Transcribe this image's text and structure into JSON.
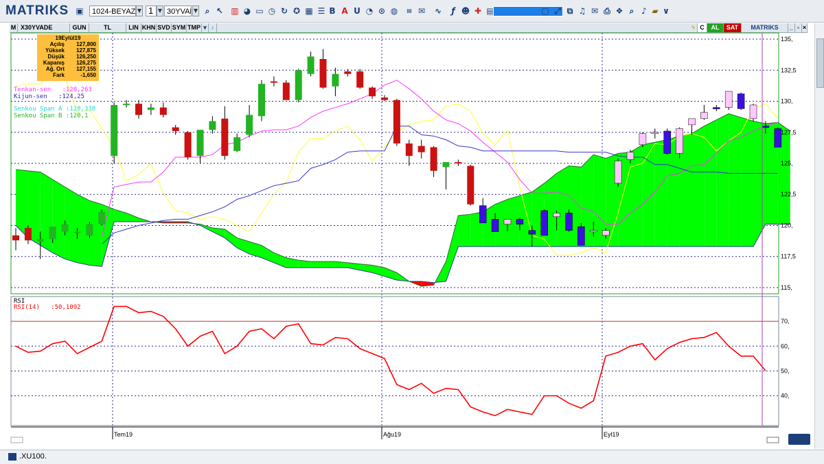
{
  "toolbar": {
    "logo": "MATRIKS",
    "layout_combo": "1024-BEYAZ-1",
    "page_combo": "1",
    "symbol_combo": "30YVADE",
    "dropdown_glyph": "▼",
    "buttons": [
      "B",
      "A",
      "U"
    ]
  },
  "chart_bar": {
    "symbol": "X30YVADE",
    "tabs": [
      "GUN",
      "TL",
      "LIN",
      "KHN",
      "SVD",
      "SYM",
      "TMP"
    ],
    "right_labels": [
      "C",
      "AL",
      "SAT"
    ],
    "brand": "MATRIKS",
    "left_label": "M"
  },
  "info_box": {
    "date": "19Eylül19",
    "rows": [
      {
        "label": "Açılış",
        "value": "127,800"
      },
      {
        "label": "Yüksek",
        "value": "127,875"
      },
      {
        "label": "Düşük",
        "value": "126,250"
      },
      {
        "label": "Kapanış",
        "value": "126,275"
      },
      {
        "label": "Ağ. Ort",
        "value": "127,155"
      },
      {
        "label": "Fark",
        "value": "-1,650"
      }
    ]
  },
  "legends": {
    "tenkan": "Tenkan-sen   :128,263",
    "kijun": "Kijun-sen   :124,25",
    "span_a": "Senkou Span A :128,338",
    "span_b": "Senkou Span B :120,1"
  },
  "rsi": {
    "title": "RSI",
    "label": "RSI(14)   :50,1092"
  },
  "status": {
    "text": ".XU100."
  },
  "colors": {
    "bull": "#22b422",
    "bear": "#cc1111",
    "cloud_bull": "#00ff00",
    "cloud_bear": "#ff0000",
    "tenkan": "#ff33ff",
    "kijun": "#3333cc",
    "chikou": "#ffff33",
    "rsi": "#ff0000"
  },
  "chart_data": [
    {
      "type": "candlestick",
      "title": "X30YVADE",
      "x_ticks": [
        "Tem19",
        "Ağu19",
        "Eyl19"
      ],
      "y_ticks": [
        "135,",
        "132,5",
        "130,",
        "127,5",
        "125,",
        "122,5",
        "120,",
        "117,5",
        "115,"
      ],
      "ylim": [
        114.5,
        135.5
      ],
      "candles": [
        {
          "o": 119.2,
          "h": 119.8,
          "l": 118.0,
          "c": 118.8
        },
        {
          "o": 119.8,
          "h": 120.0,
          "l": 118.5,
          "c": 118.8
        },
        {
          "o": 118.7,
          "h": 119.5,
          "l": 117.3,
          "c": 118.9
        },
        {
          "o": 118.9,
          "h": 119.9,
          "l": 118.6,
          "c": 119.9
        },
        {
          "o": 119.5,
          "h": 120.4,
          "l": 119.2,
          "c": 120.1
        },
        {
          "o": 119.4,
          "h": 119.8,
          "l": 118.9,
          "c": 119.5
        },
        {
          "o": 119.2,
          "h": 120.3,
          "l": 119.0,
          "c": 120.1
        },
        {
          "o": 120.1,
          "h": 121.3,
          "l": 120.0,
          "c": 121.1
        },
        {
          "o": 125.6,
          "h": 129.9,
          "l": 125.0,
          "c": 129.7
        },
        {
          "o": 129.7,
          "h": 130.1,
          "l": 129.5,
          "c": 129.8
        },
        {
          "o": 129.8,
          "h": 130.1,
          "l": 128.6,
          "c": 128.9
        },
        {
          "o": 129.3,
          "h": 129.8,
          "l": 128.9,
          "c": 129.5
        },
        {
          "o": 129.5,
          "h": 129.9,
          "l": 128.7,
          "c": 128.9
        },
        {
          "o": 127.9,
          "h": 128.1,
          "l": 127.3,
          "c": 127.6
        },
        {
          "o": 127.5,
          "h": 127.6,
          "l": 125.3,
          "c": 125.5
        },
        {
          "o": 125.6,
          "h": 127.6,
          "l": 125.0,
          "c": 127.7
        },
        {
          "o": 127.7,
          "h": 128.8,
          "l": 127.4,
          "c": 128.4
        },
        {
          "o": 128.6,
          "h": 129.6,
          "l": 125.3,
          "c": 125.6
        },
        {
          "o": 126.0,
          "h": 127.4,
          "l": 125.9,
          "c": 127.1
        },
        {
          "o": 127.3,
          "h": 129.7,
          "l": 127.1,
          "c": 128.9
        },
        {
          "o": 128.8,
          "h": 131.7,
          "l": 128.4,
          "c": 131.4
        },
        {
          "o": 131.6,
          "h": 132.0,
          "l": 131.2,
          "c": 131.5
        },
        {
          "o": 131.5,
          "h": 131.7,
          "l": 130.1,
          "c": 130.1
        },
        {
          "o": 130.1,
          "h": 132.6,
          "l": 129.9,
          "c": 132.5
        },
        {
          "o": 132.2,
          "h": 134.0,
          "l": 132.0,
          "c": 133.6
        },
        {
          "o": 133.4,
          "h": 134.2,
          "l": 131.0,
          "c": 131.1
        },
        {
          "o": 131.2,
          "h": 132.7,
          "l": 130.4,
          "c": 132.2
        },
        {
          "o": 132.4,
          "h": 132.6,
          "l": 132.0,
          "c": 132.2
        },
        {
          "o": 132.4,
          "h": 132.6,
          "l": 131.0,
          "c": 131.1
        },
        {
          "o": 131.1,
          "h": 131.2,
          "l": 130.2,
          "c": 130.4
        },
        {
          "o": 130.3,
          "h": 130.5,
          "l": 130.0,
          "c": 130.1
        },
        {
          "o": 130.1,
          "h": 130.2,
          "l": 126.4,
          "c": 126.6
        },
        {
          "o": 126.6,
          "h": 126.9,
          "l": 124.8,
          "c": 125.6
        },
        {
          "o": 126.4,
          "h": 126.9,
          "l": 125.4,
          "c": 125.9
        },
        {
          "o": 126.3,
          "h": 126.4,
          "l": 123.9,
          "c": 124.4
        },
        {
          "o": 124.7,
          "h": 125.0,
          "l": 122.9,
          "c": 125.1
        },
        {
          "o": 125.1,
          "h": 125.3,
          "l": 124.8,
          "c": 125.0
        },
        {
          "o": 124.8,
          "h": 124.9,
          "l": 121.6,
          "c": 121.7
        },
        {
          "o": 121.6,
          "h": 122.2,
          "l": 120.7,
          "c": 120.2
        },
        {
          "o": 120.5,
          "h": 121.0,
          "l": 119.5,
          "c": 119.5
        },
        {
          "o": 120.1,
          "h": 120.5,
          "l": 119.5,
          "c": 120.5
        },
        {
          "o": 120.5,
          "h": 120.6,
          "l": 119.6,
          "c": 120.1
        },
        {
          "o": 119.6,
          "h": 120.0,
          "l": 118.3,
          "c": 119.3
        },
        {
          "o": 121.2,
          "h": 121.3,
          "l": 119.2,
          "c": 119.2
        },
        {
          "o": 120.7,
          "h": 121.2,
          "l": 119.6,
          "c": 121.0
        },
        {
          "o": 121.0,
          "h": 121.3,
          "l": 119.5,
          "c": 119.6
        },
        {
          "o": 119.9,
          "h": 120.2,
          "l": 118.4,
          "c": 118.4
        },
        {
          "o": 119.6,
          "h": 120.3,
          "l": 119.1,
          "c": 119.6
        },
        {
          "o": 119.2,
          "h": 119.8,
          "l": 118.9,
          "c": 119.6
        },
        {
          "o": 123.4,
          "h": 125.4,
          "l": 123.1,
          "c": 125.2
        },
        {
          "o": 125.3,
          "h": 126.1,
          "l": 125.0,
          "c": 125.9
        },
        {
          "o": 126.5,
          "h": 127.5,
          "l": 126.3,
          "c": 127.4
        },
        {
          "o": 127.4,
          "h": 127.8,
          "l": 127.0,
          "c": 127.5
        },
        {
          "o": 127.6,
          "h": 127.8,
          "l": 125.7,
          "c": 125.8
        },
        {
          "o": 125.8,
          "h": 127.9,
          "l": 125.4,
          "c": 127.8
        },
        {
          "o": 128.1,
          "h": 128.3,
          "l": 127.3,
          "c": 128.6
        },
        {
          "o": 128.6,
          "h": 129.7,
          "l": 128.5,
          "c": 129.1
        },
        {
          "o": 129.5,
          "h": 129.7,
          "l": 129.2,
          "c": 129.4
        },
        {
          "o": 129.5,
          "h": 130.8,
          "l": 129.3,
          "c": 130.8
        },
        {
          "o": 130.6,
          "h": 130.7,
          "l": 129.3,
          "c": 129.4
        },
        {
          "o": 128.6,
          "h": 129.8,
          "l": 128.4,
          "c": 129.7
        },
        {
          "o": 128.0,
          "h": 128.4,
          "l": 127.4,
          "c": 127.9
        },
        {
          "o": 127.8,
          "h": 127.9,
          "l": 126.3,
          "c": 126.3
        }
      ],
      "tenkan": [
        null,
        null,
        null,
        null,
        null,
        null,
        null,
        119.1,
        123.1,
        123.3,
        123.5,
        123.5,
        124.3,
        125.5,
        125.5,
        125.5,
        125.7,
        126.5,
        126.7,
        127.2,
        127.6,
        127.7,
        127.7,
        128.0,
        128.7,
        129.2,
        129.5,
        129.8,
        130.2,
        130.6,
        131.3,
        131.7,
        131.0,
        130.2,
        129.2,
        128.5,
        128.2,
        127.6,
        126.7,
        125.9,
        125.1,
        123.7,
        122.6,
        122.6,
        122.7,
        122.4,
        121.4,
        121.1,
        120.1,
        120.1,
        121.0,
        121.7,
        122.7,
        124.0,
        124.2,
        124.8,
        124.9,
        125.8,
        126.8,
        127.1,
        127.6,
        128.0,
        128.3
      ],
      "kijun": [
        null,
        null,
        null,
        null,
        null,
        null,
        null,
        118.5,
        119.4,
        119.7,
        120.0,
        120.2,
        120.4,
        120.5,
        120.5,
        120.8,
        121.1,
        121.5,
        122.1,
        122.4,
        122.8,
        123.2,
        123.4,
        123.6,
        124.6,
        124.9,
        125.3,
        125.9,
        126.0,
        126.0,
        126.0,
        128.0,
        128.0,
        127.3,
        127.2,
        126.9,
        126.4,
        126.3,
        126.0,
        126.0,
        126.0,
        126.0,
        126.0,
        126.0,
        126.0,
        125.9,
        125.9,
        125.9,
        125.9,
        125.6,
        125.5,
        125.5,
        124.9,
        124.9,
        124.6,
        124.3,
        124.3,
        124.3,
        124.2,
        124.2,
        124.2,
        124.2,
        124.2
      ],
      "chikou": [
        131.2,
        131.4,
        131.4,
        132.6,
        132.0,
        129.1,
        129.3,
        127.8,
        126.3,
        123.6,
        124.1,
        125.0,
        122.6,
        121.2,
        121.0,
        120.5,
        120.7,
        120.5,
        120.0,
        119.5,
        121.0,
        122.5,
        123.5,
        125.9,
        127.0,
        127.0,
        127.6,
        128.0,
        126.9,
        125.2,
        126.3,
        127.5,
        128.1,
        128.4,
        128.5,
        129.6,
        129.8,
        129.2,
        127.4,
        126.5,
        127.7,
        123.1,
        119.2,
        118.9,
        117.6,
        117.6,
        117.8,
        118.2,
        117.8,
        121.0,
        124.7,
        125.0,
        126.6,
        126.5,
        127.2,
        127.4,
        127.1,
        126.0,
        126.8,
        127.5,
        129.4,
        129.8,
        128.6
      ],
      "span_a": [
        124.5,
        124.4,
        124.3,
        123.7,
        123.1,
        122.5,
        122.0,
        121.7,
        121.3,
        121.0,
        120.6,
        120.3,
        120.2,
        120.2,
        120.2,
        120.1,
        119.8,
        119.7,
        119.0,
        118.7,
        118.4,
        117.8,
        117.4,
        117.2,
        117.1,
        117.1,
        117.1,
        117.0,
        116.9,
        116.8,
        116.6,
        116.2,
        115.5,
        115.1,
        115.2,
        117.1,
        120.8,
        120.9,
        121.1,
        121.7,
        122.1,
        122.4,
        122.7,
        123.4,
        124.2,
        124.8,
        124.7,
        125.7,
        125.4,
        125.8,
        125.9,
        126.5,
        126.7,
        126.9,
        127.2,
        127.4,
        128.0,
        128.5,
        129.0,
        128.7,
        128.4,
        128.2,
        128.3,
        127.6
      ],
      "span_b": [
        120.0,
        119.0,
        118.4,
        117.8,
        117.3,
        117.0,
        116.8,
        116.7,
        120.3,
        120.3,
        120.3,
        120.3,
        120.3,
        120.3,
        120.3,
        120.0,
        119.5,
        119.0,
        118.2,
        117.7,
        117.4,
        117.0,
        116.6,
        116.6,
        116.6,
        116.6,
        116.6,
        116.6,
        116.4,
        116.2,
        115.9,
        115.6,
        115.5,
        115.5,
        115.4,
        115.5,
        118.3,
        118.3,
        118.3,
        118.3,
        118.3,
        118.3,
        118.3,
        118.3,
        118.3,
        118.3,
        118.3,
        118.3,
        118.3,
        118.3,
        118.3,
        118.3,
        118.3,
        118.3,
        118.3,
        118.3,
        118.3,
        118.3,
        118.3,
        118.3,
        118.3,
        120.1,
        120.1,
        120.1
      ]
    },
    {
      "type": "line",
      "title": "RSI",
      "series": [
        {
          "name": "RSI(14)",
          "values": [
            60.0,
            57.5,
            58.0,
            61.0,
            62.0,
            57.0,
            59.5,
            62.0,
            76.0,
            76.0,
            73.5,
            74.0,
            72.0,
            67.0,
            60.0,
            64.0,
            66.0,
            57.0,
            60.0,
            66.0,
            67.0,
            63.0,
            68.0,
            69.0,
            61.0,
            60.5,
            63.5,
            63.0,
            59.0,
            57.0,
            55.0,
            44.5,
            42.5,
            45.0,
            41.0,
            43.0,
            42.5,
            35.5,
            33.5,
            32.0,
            34.5,
            33.5,
            32.5,
            40.0,
            40.0,
            37.0,
            35.0,
            38.0,
            56.0,
            57.5,
            60.0,
            61.0,
            54.5,
            59.0,
            61.5,
            63.0,
            63.5,
            65.5,
            60.0,
            56.0,
            56.0,
            50.1
          ]
        }
      ],
      "y_ticks": [
        "70,",
        "60,",
        "50,",
        "40,"
      ],
      "ylim": [
        28,
        80
      ],
      "hline": 70
    }
  ]
}
